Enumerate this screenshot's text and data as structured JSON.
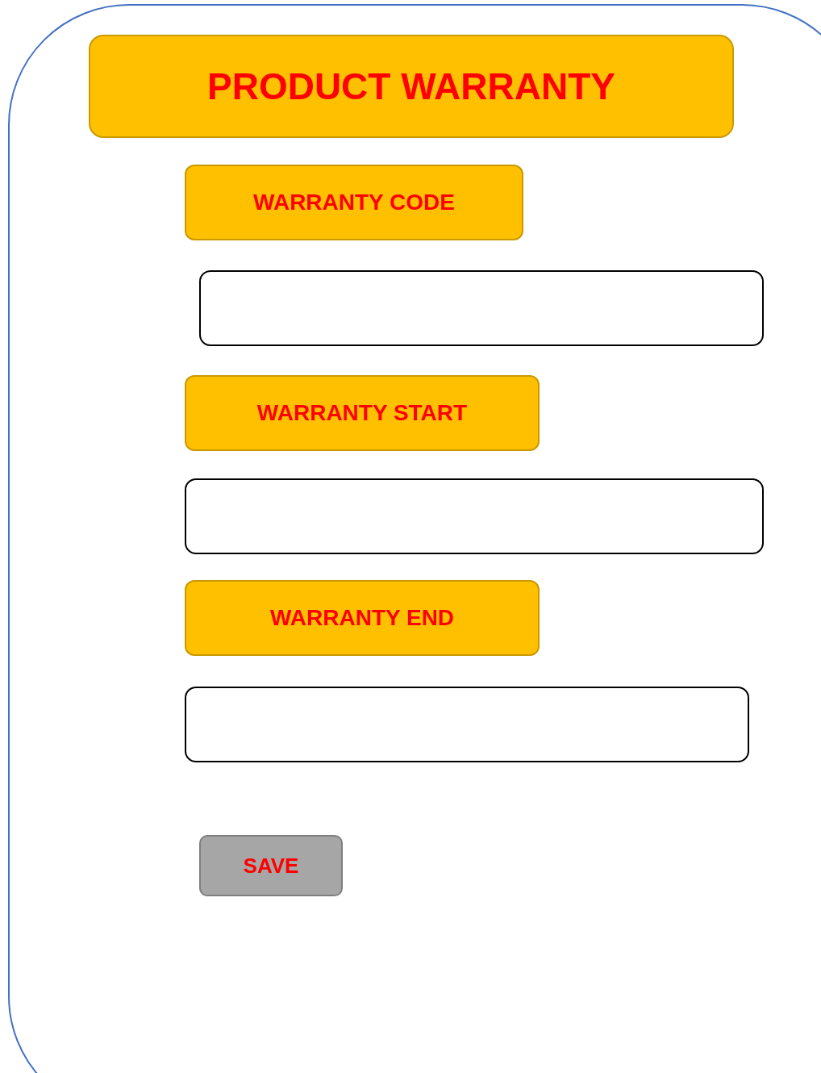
{
  "title": "PRODUCT WARRANTY",
  "fields": [
    {
      "label": "WARRANTY CODE"
    },
    {
      "label": "WARRANTY START"
    },
    {
      "label": "WARRANTY END"
    }
  ],
  "save_button": "SAVE"
}
